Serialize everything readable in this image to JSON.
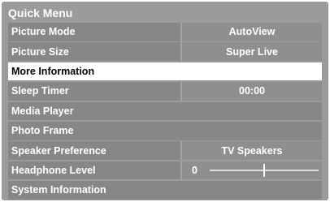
{
  "menu": {
    "title": "Quick Menu",
    "items": [
      {
        "label": "Picture Mode",
        "value": "AutoView"
      },
      {
        "label": "Picture Size",
        "value": "Super Live"
      },
      {
        "label": "More Information",
        "selected": true
      },
      {
        "label": "Sleep Timer",
        "value": "00:00"
      },
      {
        "label": "Media Player"
      },
      {
        "label": "Photo Frame"
      },
      {
        "label": "Speaker Preference",
        "value": "TV Speakers"
      },
      {
        "label": "Headphone Level",
        "value": "0",
        "slider_level": 0.49
      },
      {
        "label": "System Information"
      }
    ]
  }
}
